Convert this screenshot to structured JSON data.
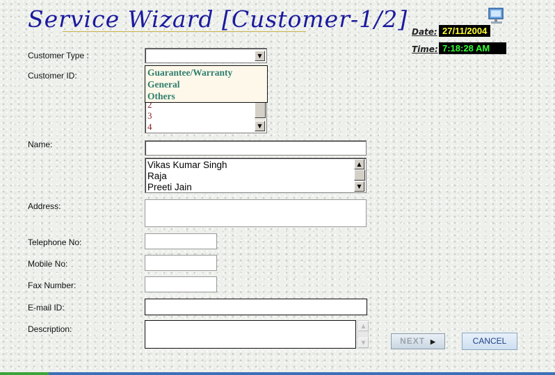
{
  "header": {
    "title": "Service Wizard [Customer-1/2]",
    "date_label": "Date:",
    "date_value": "27/11/2004",
    "time_label": "Time:",
    "time_value": "7:18:28 AM",
    "date_color": "#ffff33",
    "time_color": "#33ff33",
    "icon": "computer-monitor-icon"
  },
  "form": {
    "customer_type_label": "Customer Type :",
    "customer_type_value": "",
    "customer_type_options": [
      "Guarantee/Warranty",
      "General",
      "Others"
    ],
    "customer_id_label": "Customer ID:",
    "customer_id_list": [
      "2",
      "3",
      "4"
    ],
    "name_label": "Name:",
    "name_value": "",
    "name_list": [
      "Vikas Kumar Singh",
      "Raja",
      "Preeti Jain"
    ],
    "address_label": "Address:",
    "telephone_label": "Telephone No:",
    "mobile_label": "Mobile No:",
    "fax_label": "Fax Number:",
    "email_label": "E-mail ID:",
    "description_label": "Description:"
  },
  "buttons": {
    "next_label": "NEXT",
    "cancel_label": "CANCEL"
  },
  "colors": {
    "title": "#1a1a9e",
    "dropdown_option": "#2f7e6e",
    "id_item": "#8b1a1a"
  }
}
